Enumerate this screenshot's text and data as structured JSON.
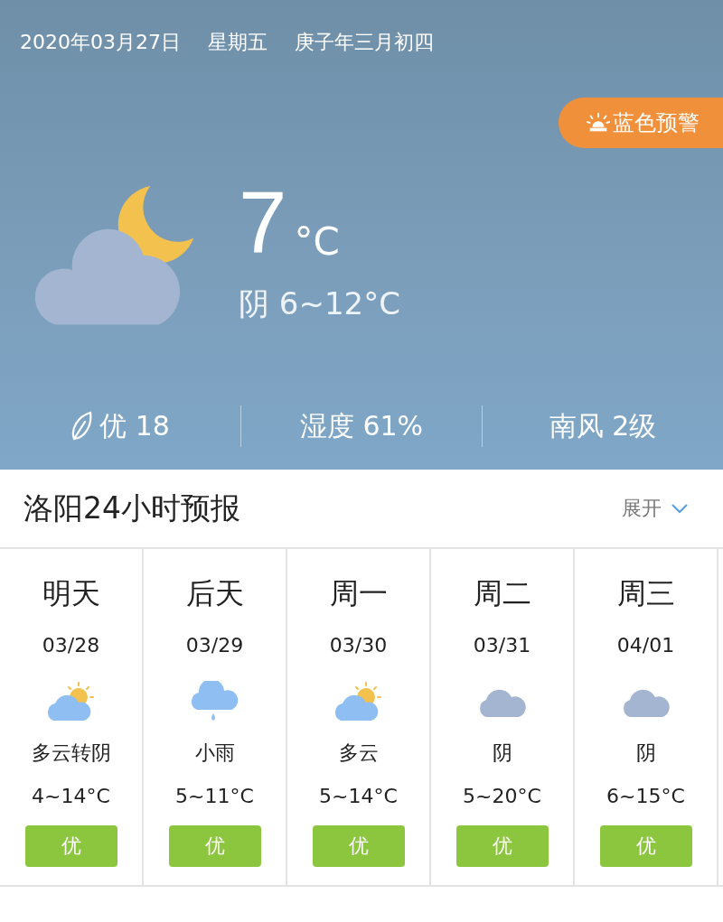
{
  "header": {
    "date": "2020年03月27日",
    "weekday": "星期五",
    "lunar": "庚子年三月初四"
  },
  "alert": {
    "label": "蓝色预警"
  },
  "current": {
    "kind": "cloudy-night",
    "temperature": "7",
    "unit": "°C",
    "summary": "阴 6~12°C"
  },
  "stats": [
    {
      "kind": "air",
      "text": "优 18"
    },
    {
      "kind": "plain",
      "text": "湿度 61%"
    },
    {
      "kind": "plain",
      "text": "南风 2级"
    }
  ],
  "forecast": {
    "title": "洛阳24小时预报",
    "toggle": "展开",
    "days": [
      {
        "day": "明天",
        "date": "03/28",
        "kind": "partly-cloudy",
        "desc": "多云转阴",
        "temp": "4~14°C",
        "aqi": "优"
      },
      {
        "day": "后天",
        "date": "03/29",
        "kind": "rain",
        "desc": "小雨",
        "temp": "5~11°C",
        "aqi": "优"
      },
      {
        "day": "周一",
        "date": "03/30",
        "kind": "partly-cloudy",
        "desc": "多云",
        "temp": "5~14°C",
        "aqi": "优"
      },
      {
        "day": "周二",
        "date": "03/31",
        "kind": "overcast",
        "desc": "阴",
        "temp": "5~20°C",
        "aqi": "优"
      },
      {
        "day": "周三",
        "date": "04/01",
        "kind": "overcast",
        "desc": "阴",
        "temp": "6~15°C",
        "aqi": "优"
      }
    ]
  }
}
